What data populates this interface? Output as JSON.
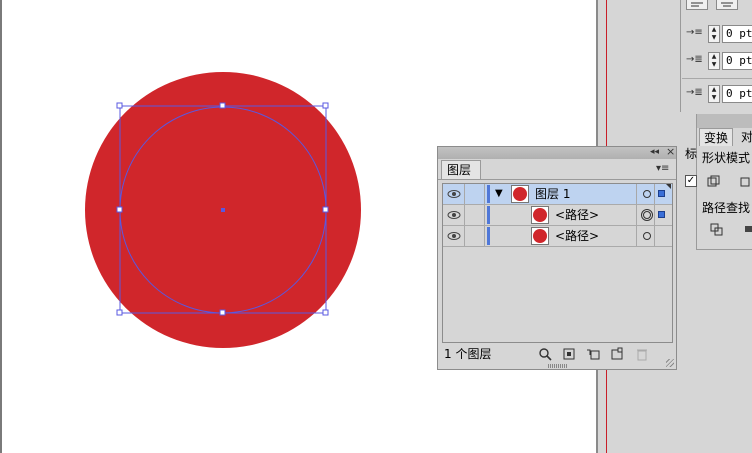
{
  "colors": {
    "fill_red": "#d0262b",
    "selection_blue": "#5a58e0",
    "layer_row_selected": "#bed3f0",
    "panel_gray": "#d6d6d6"
  },
  "canvas": {
    "shape": "red-circle",
    "selected_path": "circle-selection-bounding-box"
  },
  "paragraph_panel": {
    "indent_left": "0 pt",
    "indent_first_line": "0 pt",
    "space_before": "0 pt"
  },
  "pathfinder_panel": {
    "tabs": [
      "变换",
      "对"
    ],
    "cut_label": "标",
    "shape_modes_label": "形状模式",
    "pathfinders_label": "路径查找"
  },
  "layers_panel": {
    "collapse_glyph": "◂◂",
    "close_glyph": "×",
    "menu_glyph": "▾≡",
    "tab_label": "图层",
    "rows": [
      {
        "label": "图层 1",
        "expanded": true,
        "selected": true
      },
      {
        "label": "<路径>",
        "selected": false
      },
      {
        "label": "<路径>",
        "selected": false
      }
    ],
    "footer_count": "1 个图层",
    "icons": [
      "locate-object-icon",
      "make-clipping-mask-icon",
      "create-sublayer-icon",
      "new-layer-icon",
      "delete-layer-icon"
    ]
  }
}
